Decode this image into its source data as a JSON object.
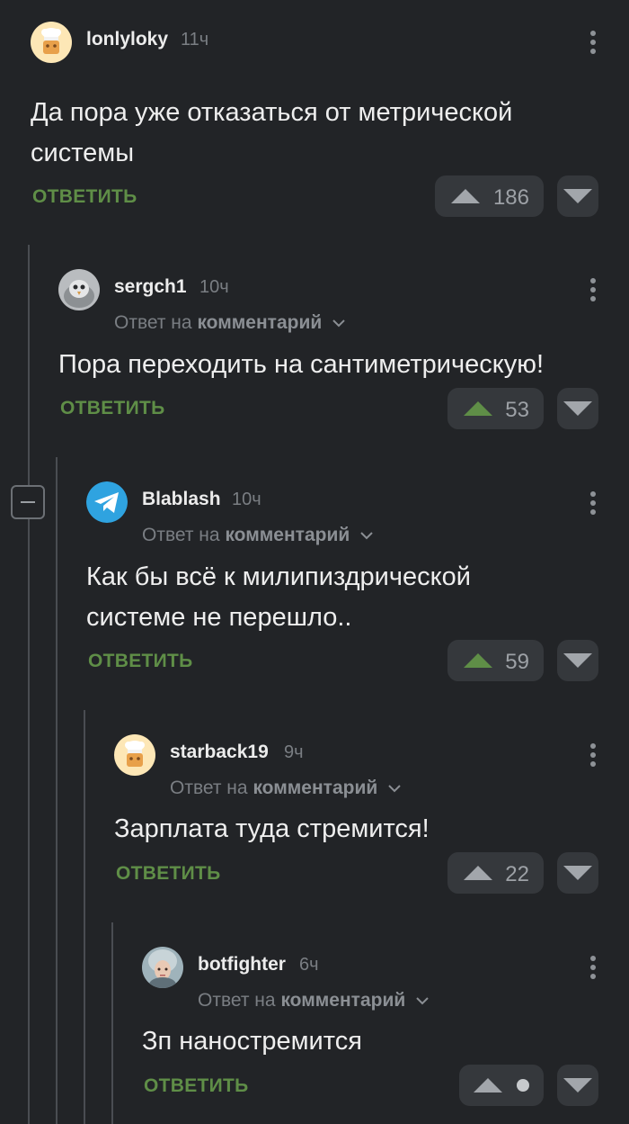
{
  "colors": {
    "background": "#222427",
    "reply_green": "#5f8e47",
    "upvoted_arrow": "#5f8e47",
    "neutral_arrow": "#a2a6ab",
    "muted_text": "#7a7e83"
  },
  "comments": [
    {
      "author": "lonlyloky",
      "time": "11ч",
      "text": "Да пора уже отказаться от метрической системы",
      "reply_label": "ОТВЕТИТЬ",
      "rating": "186",
      "upvoted": false
    },
    {
      "author": "sergch1",
      "time": "10ч",
      "reply_prefix": "Ответ на",
      "reply_target": "комментарий",
      "text": "Пора переходить на сантиметрическую!",
      "reply_label": "ОТВЕТИТЬ",
      "rating": "53",
      "upvoted": true
    },
    {
      "author": "Blablash",
      "time": "10ч",
      "reply_prefix": "Ответ на",
      "reply_target": "комментарий",
      "text": "Как бы всё к милипиздрической системе не перешло..",
      "reply_label": "ОТВЕТИТЬ",
      "rating": "59",
      "upvoted": true
    },
    {
      "author": "starback19",
      "time": "9ч",
      "reply_prefix": "Ответ на",
      "reply_target": "комментарий",
      "text": "Зарплата туда стремится!",
      "reply_label": "ОТВЕТИТЬ",
      "rating": "22",
      "upvoted": false
    },
    {
      "author": "botfighter",
      "time": "6ч",
      "reply_prefix": "Ответ на",
      "reply_target": "комментарий",
      "text": "Зп наностремится",
      "reply_label": "ОТВЕТИТЬ",
      "rating": "",
      "upvoted": false
    }
  ],
  "icons": {
    "upvote": "triangle-up-icon",
    "downvote": "triangle-down-icon",
    "more": "vertical-dots-icon",
    "collapse": "minus-square-icon",
    "reply_dropdown": "chevron-down-icon",
    "hidden_rating": "dot-icon"
  }
}
